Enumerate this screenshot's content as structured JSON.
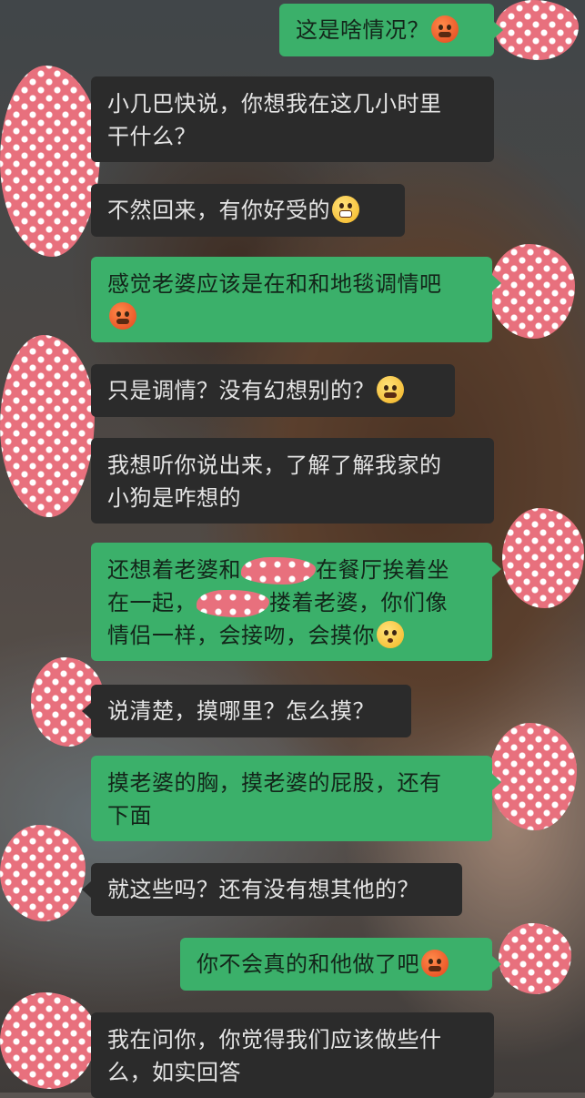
{
  "colors": {
    "incoming_bubble": "#2b2b2b",
    "outgoing_bubble": "#3bb06a",
    "avatar_mask": "#e8707d"
  },
  "messages": [
    {
      "side": "out",
      "lines": [
        "这是啥情况？"
      ],
      "emoji": "angry-sweat-emoji"
    },
    {
      "side": "in",
      "lines": [
        "小几巴快说，你想我在这几小时里",
        "干什么？"
      ]
    },
    {
      "side": "in",
      "lines": [
        "不然回来，有你好受的"
      ],
      "emoji": "grin-emoji"
    },
    {
      "side": "out",
      "lines": [
        "感觉老婆应该是在和和地毯调情吧",
        ""
      ],
      "emoji": "angry-sweat-emoji"
    },
    {
      "side": "in",
      "lines": [
        "只是调情？没有幻想别的？"
      ],
      "emoji": "thinking-emoji"
    },
    {
      "side": "in",
      "lines": [
        "我想听你说出来，了解了解我家的",
        "小狗是咋想的"
      ]
    },
    {
      "side": "out",
      "segments": [
        "还想着老婆和",
        "在餐厅挨着坐",
        "在一起，",
        "搂着老婆，你们像",
        "情侣一样，会接吻，会摸你"
      ],
      "emoji": "flushed-emoji"
    },
    {
      "side": "in",
      "lines": [
        "说清楚，摸哪里？怎么摸？"
      ]
    },
    {
      "side": "out",
      "lines": [
        "摸老婆的胸，摸老婆的屁股，还有",
        "下面"
      ]
    },
    {
      "side": "in",
      "lines": [
        "就这些吗？还有没有想其他的？"
      ]
    },
    {
      "side": "out",
      "lines": [
        "你不会真的和他做了吧"
      ],
      "emoji": "angry-sweat-emoji"
    },
    {
      "side": "in",
      "lines": [
        "我在问你，你觉得我们应该做些什",
        "么，如实回答"
      ]
    }
  ]
}
